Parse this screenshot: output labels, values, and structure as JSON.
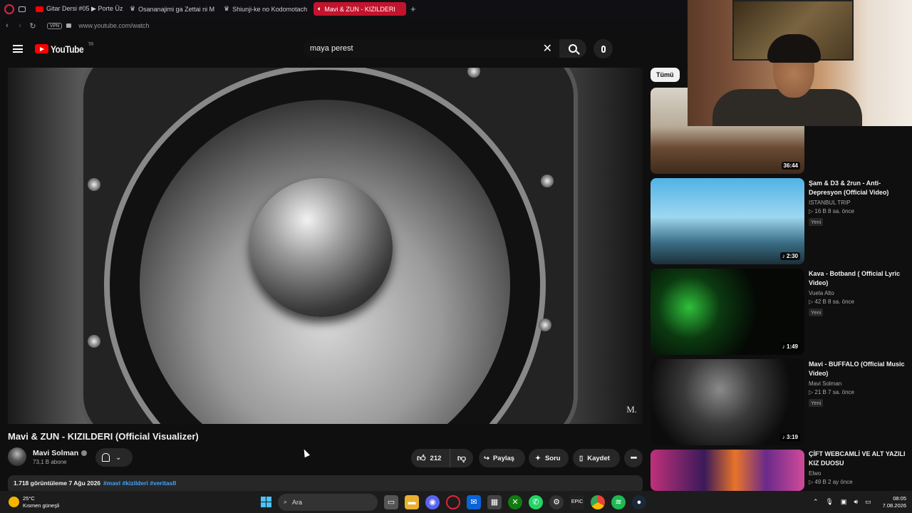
{
  "browser": {
    "tabs": [
      {
        "label": "Gitar Dersi #05 ▶ Porte Üz",
        "icon": "youtube-icon"
      },
      {
        "label": "Osananajimi ga Zettai ni M",
        "icon": "crown-icon"
      },
      {
        "label": "Shiunji-ke no Kodomotach",
        "icon": "crown-icon"
      },
      {
        "label": "Mavi & ZUN - KIZILDERI",
        "icon": "speaker-icon",
        "active": true
      }
    ],
    "new_tab": "+",
    "vpn": "VPN",
    "url": "www.youtube.com/watch"
  },
  "youtube": {
    "logo_text": "YouTube",
    "region": "TR",
    "search_value": "maya perest"
  },
  "video": {
    "title": "Mavi & ZUN - KIZILDERI (Official Visualizer)",
    "watermark": "M.",
    "channel": "Mavi Solman",
    "subscribers": "73,1 B abone",
    "likes": "212",
    "share": "Paylaş",
    "ask": "Soru",
    "save": "Kaydet",
    "more": "•••",
    "views_date": "1.718 görüntüleme  7 Ağu 2026",
    "tags": "#mavi #kizilderi #veritasII"
  },
  "sidebar": {
    "chip": "Tümü",
    "items": [
      {
        "duration": "36:44"
      },
      {
        "title": "Şam & D3 & 2run - Anti-Depresyon (Official Video)",
        "channel": "ISTANBUL TRIP",
        "meta": "▷ 16 B  8 sa. önce",
        "badge": "Yeni",
        "duration": "♪ 2:30"
      },
      {
        "title": "Kava - Botband ( Official Lyric Video)",
        "channel": "Vuela Alto",
        "meta": "▷ 42 B  8 sa. önce",
        "badge": "Yeni",
        "duration": "♪ 1:49"
      },
      {
        "title": "Mavi - BUFFALO (Official Music Video)",
        "channel": "Mavi Solman",
        "meta": "▷ 21 B  7 sa. önce",
        "badge": "Yeni",
        "duration": "♪ 3:19"
      },
      {
        "title": "ÇİFT WEBCAMLİ VE ALT YAZILI KIZ DUOSU",
        "channel": "Elwo",
        "meta": "▷ 49 B  2 ay önce"
      }
    ]
  },
  "taskbar": {
    "temp": "25°C",
    "weather": "Kısmen güneşli",
    "search": "Ara",
    "time": "08:05",
    "date": "7.08.2026"
  },
  "colors": {
    "accent": "#c2142d",
    "youtube_red": "#ff0000",
    "link": "#3ea6ff"
  }
}
